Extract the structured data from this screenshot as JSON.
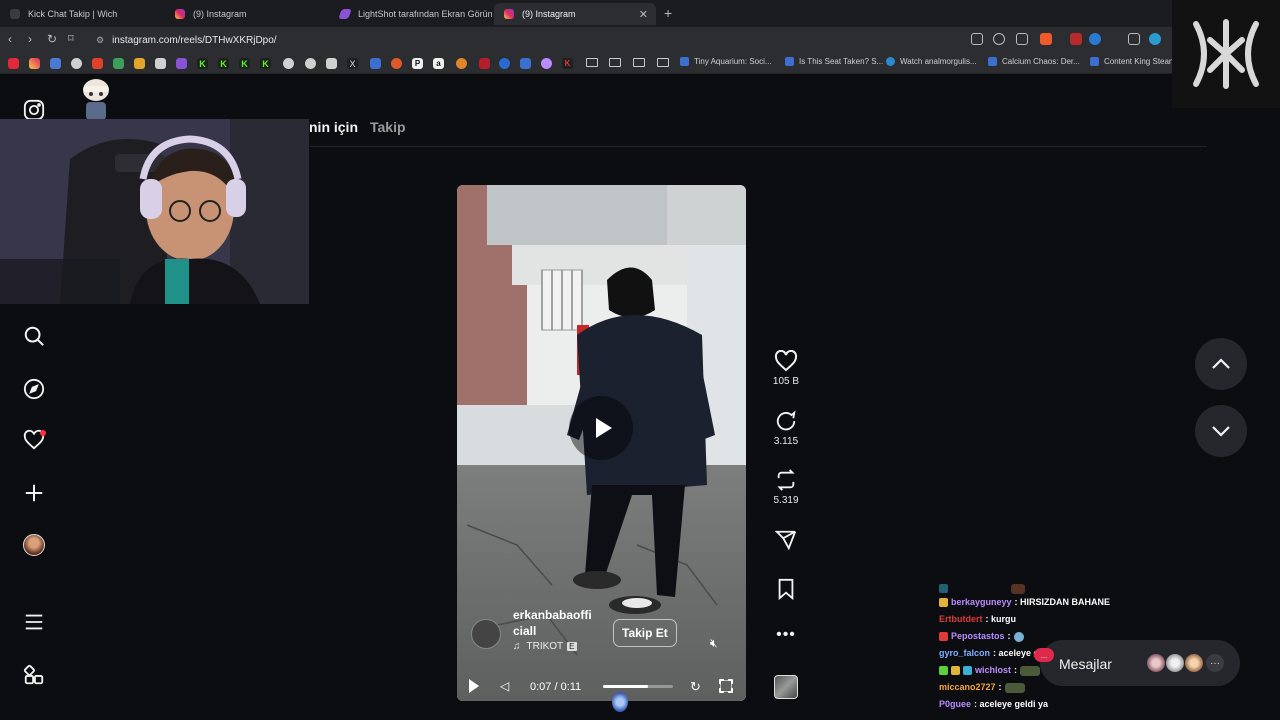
{
  "browser": {
    "tabs": [
      {
        "title": "Kick Chat Takip | Wich",
        "active": false
      },
      {
        "title": "(9) Instagram",
        "active": false
      },
      {
        "title": "LightShot tarafından Ekran Görüntüsü",
        "active": false
      },
      {
        "title": "(9) Instagram",
        "active": true
      }
    ],
    "url": "instagram.com/reels/DTHwXKRjDpo/",
    "bookmarks": [
      "Tiny Aquarium: Soci...",
      "Is This Seat Taken? S...",
      "Watch analmorgulis...",
      "Calcium Chaos: Der...",
      "Content King Stean"
    ],
    "bookmark_favicon_letters": [
      "K",
      "K",
      "K",
      "K",
      "X",
      "P",
      "a",
      "K"
    ]
  },
  "feed_tabs": {
    "for_you": "nin için",
    "following": "Takip"
  },
  "video": {
    "author": "erkanbabaofficiall",
    "author_line1": "erkanbabaoffi",
    "author_line2": "ciall",
    "audio": "TRIKOT",
    "explicit_badge": "E",
    "follow_button": "Takip Et",
    "time": "0:07 / 0:11",
    "progress": 0.64
  },
  "actions": {
    "likes": "105 B",
    "comments": "3.115",
    "reposts": "5.319"
  },
  "messages": {
    "label": "Mesajlar",
    "notification_count": "..."
  },
  "chat": [
    {
      "user": "berkayguneyy",
      "color": "#b98cff",
      "badge": "#e2b33a",
      "text": ": HIRSIZDAN BAHANE"
    },
    {
      "user": "Ertbutdert",
      "color": "#e03a3a",
      "badge": "",
      "text": ": kurgu"
    },
    {
      "user": "Pepostastos",
      "color": "#b98cff",
      "badge": "#e03a3a",
      "text": ":"
    },
    {
      "user": "gyro_falcon",
      "color": "#7fb0ff",
      "badge": "",
      "text": ": aceleye geldi"
    },
    {
      "user": "wichlost",
      "color": "#b98cff",
      "badge": "#5ad13b",
      "text": ":"
    },
    {
      "user": "miccano2727",
      "color": "#f4a63a",
      "badge": "",
      "text": ":"
    },
    {
      "user": "P0guee",
      "color": "#b98cff",
      "badge": "",
      "text": ": aceleye geldi ya"
    }
  ]
}
